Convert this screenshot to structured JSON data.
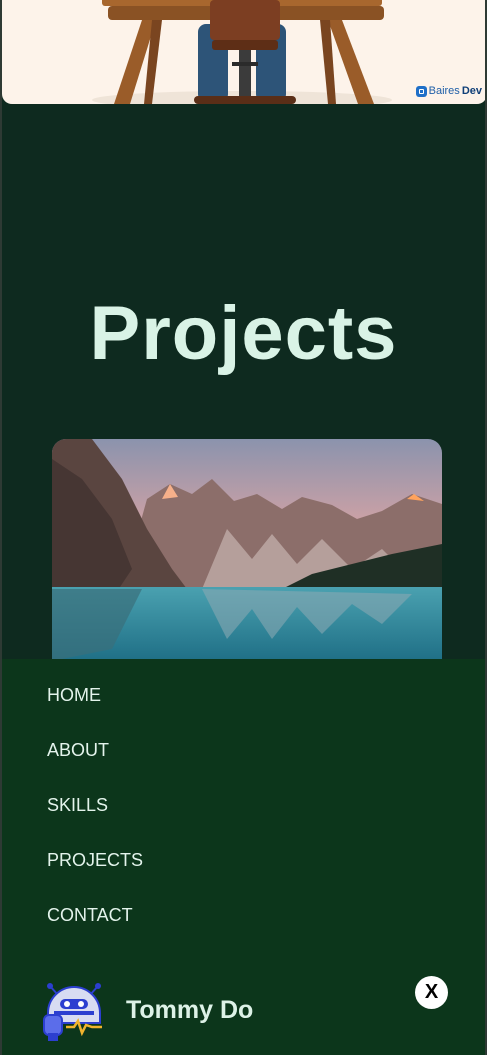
{
  "hero": {
    "brand_name_part1": "Baires",
    "brand_name_part2": "Dev",
    "background_color": "#fdf3ea"
  },
  "section": {
    "title": "Projects"
  },
  "nav": {
    "items": [
      {
        "label": "HOME"
      },
      {
        "label": "ABOUT"
      },
      {
        "label": "SKILLS"
      },
      {
        "label": "PROJECTS"
      },
      {
        "label": "CONTACT"
      }
    ],
    "brand_name": "Tommy Do",
    "avatar_icon": "robot-icon",
    "close_label": "X",
    "close_icon": "close-icon"
  },
  "colors": {
    "page_background": "#0e2a1f",
    "drawer_background": "#0c361b",
    "title_color": "#d9f3e6"
  }
}
